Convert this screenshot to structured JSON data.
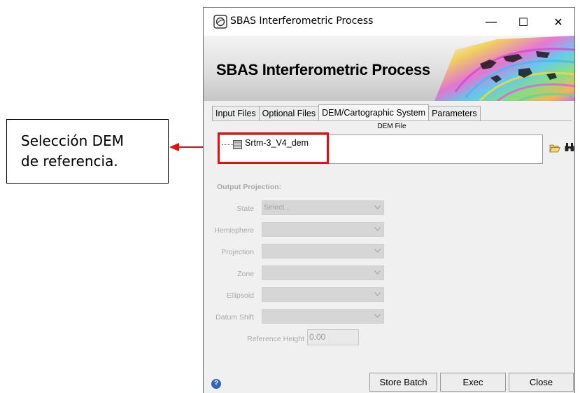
{
  "annotation": {
    "callout_lines": [
      "Selección DEM",
      "de referencia."
    ],
    "arrow_color": "#e01010"
  },
  "window": {
    "title": "SBAS Interferometric Process",
    "controls": {
      "minimize": "—",
      "maximize": "☐",
      "close": "✕"
    },
    "banner_title": "SBAS Interferometric Process"
  },
  "tabs": [
    {
      "label": "Input Files",
      "active": false
    },
    {
      "label": "Optional Files",
      "active": false
    },
    {
      "label": "DEM/Cartographic System",
      "active": true
    },
    {
      "label": "Parameters",
      "active": false
    }
  ],
  "dem": {
    "section_label": "DEM File",
    "file_name": "Srtm-3_V4_dem",
    "open_icon": "folder-open-icon",
    "browse_icon": "binoculars-icon"
  },
  "projection": {
    "heading": "Output Projection:",
    "fields": [
      {
        "label": "State",
        "value": "Select..."
      },
      {
        "label": "Hemisphere",
        "value": ""
      },
      {
        "label": "Projection",
        "value": ""
      },
      {
        "label": "Zone",
        "value": ""
      },
      {
        "label": "Ellipsoid",
        "value": ""
      },
      {
        "label": "Datum Shift",
        "value": ""
      }
    ],
    "reference_height_label": "Reference Height",
    "reference_height_value": "0.00"
  },
  "footer": {
    "help_icon": "help-icon",
    "store_batch": "Store Batch",
    "exec": "Exec",
    "close": "Close"
  }
}
